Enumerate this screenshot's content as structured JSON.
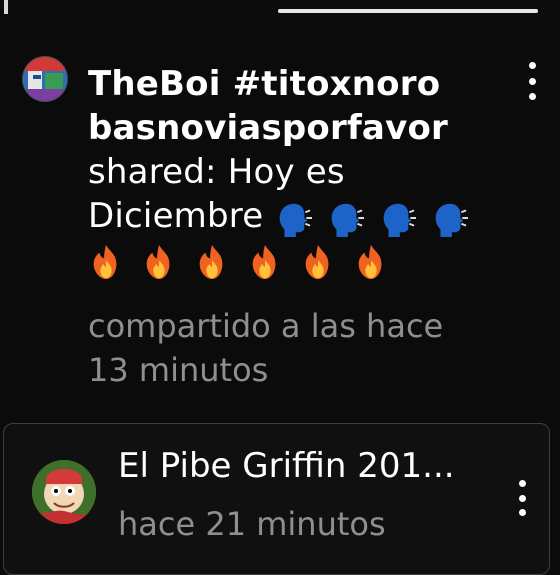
{
  "post": {
    "username": "TheBoi #titoxnoro",
    "username_cont": "basnoviasporfavor",
    "shared_prefix": "shared: Hoy es",
    "line4_text": "Diciembre",
    "meta_line1": "compartido a las hace",
    "meta_line2": "13 minutos",
    "emoji_icons": [
      "speaking-head-emoji",
      "fire-emoji"
    ]
  },
  "card": {
    "title": "El Pibe Griffin 201...",
    "time": "hace 21 minutos"
  },
  "colors": {
    "background": "#0b0b0b",
    "text_primary": "#ffffff",
    "text_secondary": "#8f8f8f",
    "card_border": "#3e3e3e"
  }
}
